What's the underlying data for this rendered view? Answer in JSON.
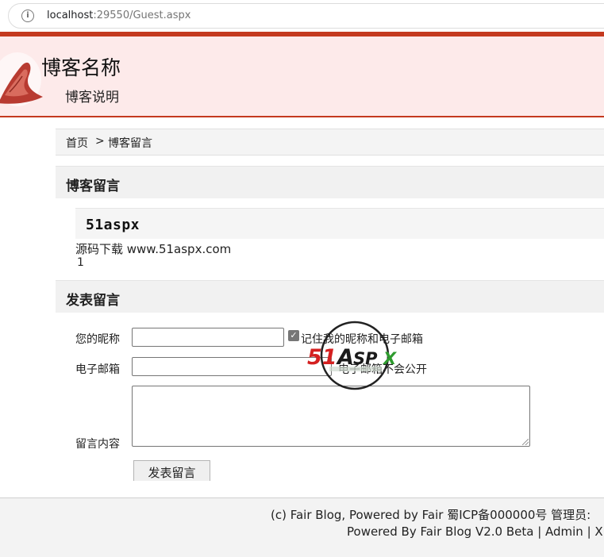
{
  "browser": {
    "url_host": "localhost",
    "url_rest": ":29550/Guest.aspx",
    "info_icon": "info-icon"
  },
  "header": {
    "title": "博客名称",
    "description": "博客说明"
  },
  "breadcrumb": {
    "home": "首页",
    "separator": ">",
    "current": "博客留言"
  },
  "guestbook": {
    "section_title": "博客留言",
    "comments": [
      {
        "author": "51aspx",
        "content": "源码下载 www.51aspx.com",
        "count": "1"
      }
    ]
  },
  "form": {
    "section_title": "发表留言",
    "nickname_label": "您的昵称",
    "nickname_value": "",
    "remember_label": "记住我的昵称和电子邮箱",
    "remember_checked": true,
    "email_label": "电子邮箱",
    "email_value": "",
    "email_note": "电子邮箱不会公开",
    "content_label": "留言内容",
    "content_value": "",
    "submit_label": "发表留言"
  },
  "watermark": {
    "text_51": "51",
    "text_a": "A",
    "text_sp": "SP",
    "text_x": "X"
  },
  "footer": {
    "line1": "(c) Fair Blog, Powered by Fair 蜀ICP备000000号 管理员:",
    "line2": "Powered By Fair Blog V2.0 Beta | Admin | X"
  },
  "colors": {
    "accent_red": "#c4391f",
    "header_bg": "#fdeaea",
    "section_bg": "#f1f1f1",
    "footer_bg": "#f3f3f3"
  }
}
